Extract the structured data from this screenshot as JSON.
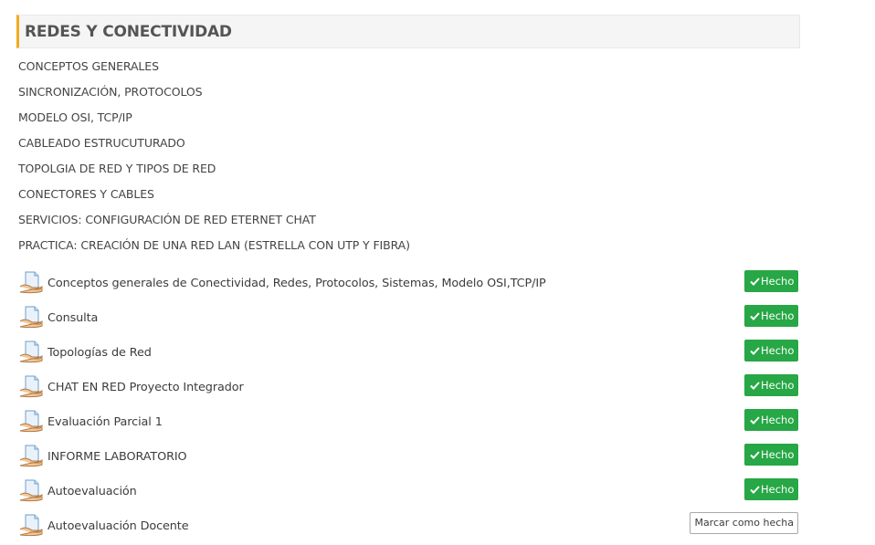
{
  "section": {
    "title": "REDES Y CONECTIVIDAD",
    "accent_color": "#f0ad1e"
  },
  "topics": [
    "CONCEPTOS GENERALES",
    "SINCRONIZACIÓN, PROTOCOLOS",
    "MODELO OSI, TCP/IP",
    "CABLEADO ESTRUCUTURADO",
    "TOPOLGIA DE RED Y TIPOS DE RED",
    "CONECTORES Y CABLES",
    "SERVICIOS: CONFIGURACIÓN DE RED ETERNET CHAT",
    "PRACTICA: CREACIÓN DE UNA RED LAN (ESTRELLA CON UTP Y FIBRA)"
  ],
  "activities": [
    {
      "name": "Conceptos generales de Conectividad, Redes, Protocolos, Sistemas, Modelo OSI,TCP/IP",
      "icon": "assignment-icon",
      "status": "Hecho"
    },
    {
      "name": "Consulta",
      "icon": "assignment-icon",
      "status": "Hecho"
    },
    {
      "name": "Topologías de Red",
      "icon": "assignment-icon",
      "status": "Hecho"
    },
    {
      "name": "CHAT EN RED Proyecto Integrador",
      "icon": "assignment-icon",
      "status": "Hecho"
    },
    {
      "name": "Evaluación Parcial 1",
      "icon": "assignment-icon",
      "status": "Hecho"
    },
    {
      "name": "INFORME LABORATORIO",
      "icon": "assignment-icon",
      "status": "Hecho"
    },
    {
      "name": "Autoevaluación",
      "icon": "assignment-icon",
      "status": "Hecho"
    },
    {
      "name": "Autoevaluación Docente",
      "icon": "assignment-icon",
      "action": "Marcar como hecha"
    }
  ],
  "colors": {
    "done_badge": "#27a745",
    "header_bg": "#f5f5f5"
  }
}
